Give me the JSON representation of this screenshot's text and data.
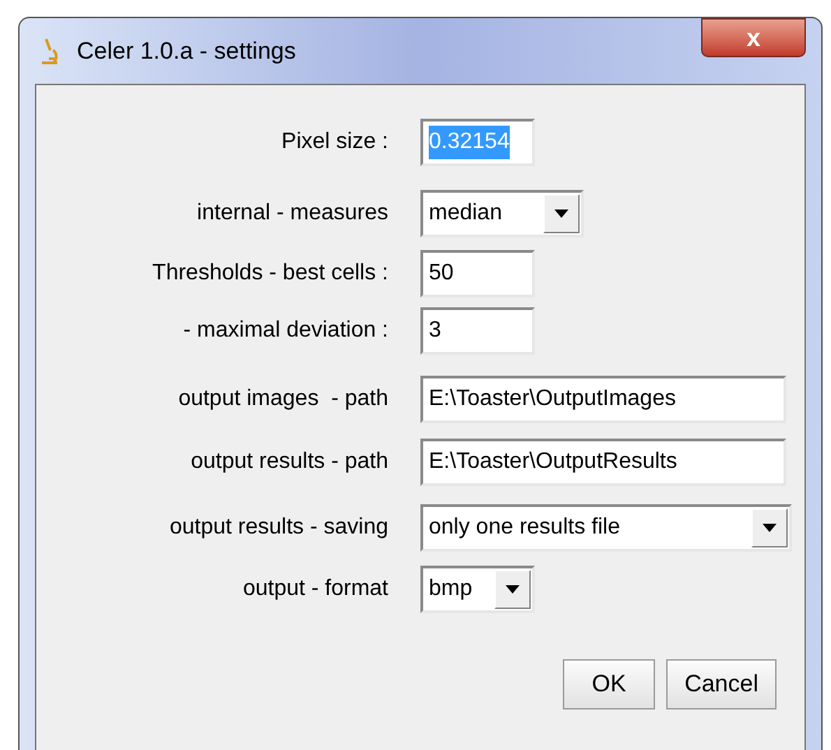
{
  "window": {
    "title": "Celer 1.0.a - settings",
    "close": "x"
  },
  "fields": [
    {
      "label": "Pixel size :",
      "kind": "text",
      "value": "0.32154",
      "text_selected": true
    },
    {
      "label": "internal - measures",
      "kind": "dropdown",
      "value": "median"
    },
    {
      "label": "Thresholds - best cells :",
      "kind": "text",
      "value": "50",
      "text_selected": false
    },
    {
      "label": "- maximal deviation :",
      "kind": "text",
      "value": "3",
      "text_selected": false
    },
    {
      "label": "output images  - path",
      "kind": "text",
      "value": "E:\\Toaster\\OutputImages",
      "text_selected": false
    },
    {
      "label": "output results - path",
      "kind": "text",
      "value": "E:\\Toaster\\OutputResults",
      "text_selected": false
    },
    {
      "label": "output results - saving",
      "kind": "dropdown",
      "value": "only one results file"
    },
    {
      "label": "output - format",
      "kind": "dropdown",
      "value": "bmp"
    }
  ],
  "buttons": [
    "OK",
    "Cancel"
  ]
}
